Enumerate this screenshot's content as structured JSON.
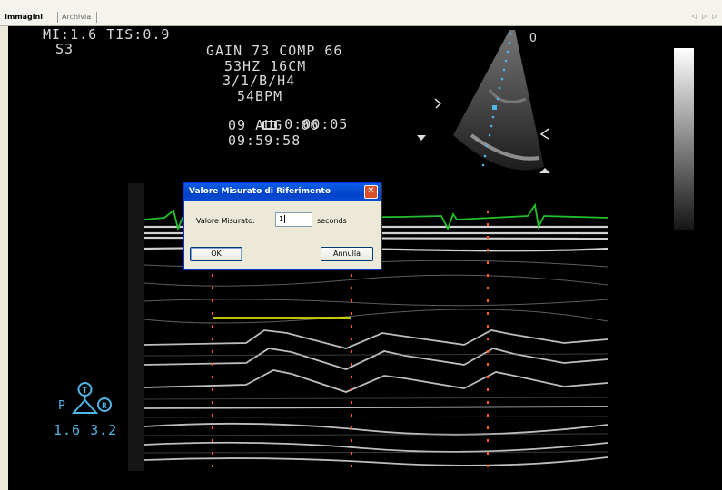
{
  "tabs": [
    {
      "label": "Immagini",
      "active": true
    },
    {
      "label": "Archivia",
      "active": false
    }
  ],
  "nav_arrows": "◁ ▷ ▷",
  "overlay": {
    "mi_tis": "MI:1.6 TIS:0.9",
    "probe_model": "S3",
    "gain_comp": "GAIN 73 COMP 66",
    "freq_depth": "53HZ 16CM",
    "mode_code": "3/1/B/H4",
    "heart_rate": "54BPM",
    "tape_time": "0:00:05",
    "date": "09 AUG  06",
    "clock": "09:59:58",
    "orientation_marker": "O"
  },
  "probe_indicator": {
    "top_symbol": "T",
    "right_symbol": "R",
    "left_letter": "P",
    "values": "1.6 3.2"
  },
  "dialog": {
    "title": "Valore Misurato di Riferimento",
    "field_label": "Valore Misurato:",
    "field_value": "1",
    "unit": "seconds",
    "ok_label": "OK",
    "cancel_label": "Annulla"
  },
  "colors": {
    "ecg": "#22c02a",
    "caliper": "#ffff00",
    "time_marker": "#ff5a2a",
    "probe": "#4fb6e8",
    "titlebar": "#0043c8"
  }
}
